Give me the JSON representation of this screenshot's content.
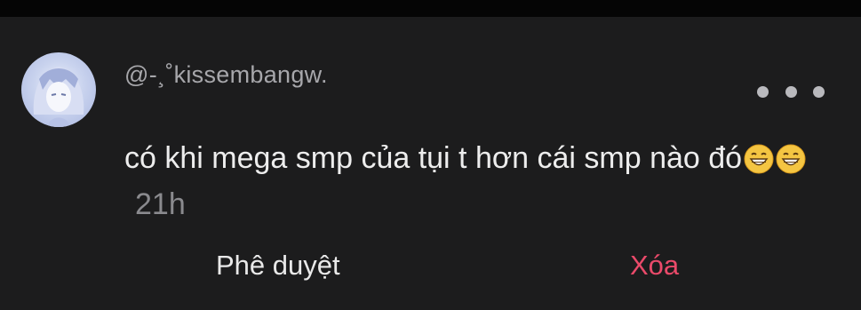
{
  "comment": {
    "username": "@-¸˚kissembangw.",
    "text": "có khi mega smp của tụi t hơn cái smp nào đó",
    "emojis": [
      "grinning-face-icon",
      "grinning-face-icon"
    ],
    "time": "21h"
  },
  "actions": {
    "approve_label": "Phê duyệt",
    "delete_label": "Xóa"
  },
  "colors": {
    "background": "#1c1c1d",
    "delete_accent": "#ea4a6a",
    "username": "#a7a7ab",
    "timestamp": "#8a8a8e"
  }
}
